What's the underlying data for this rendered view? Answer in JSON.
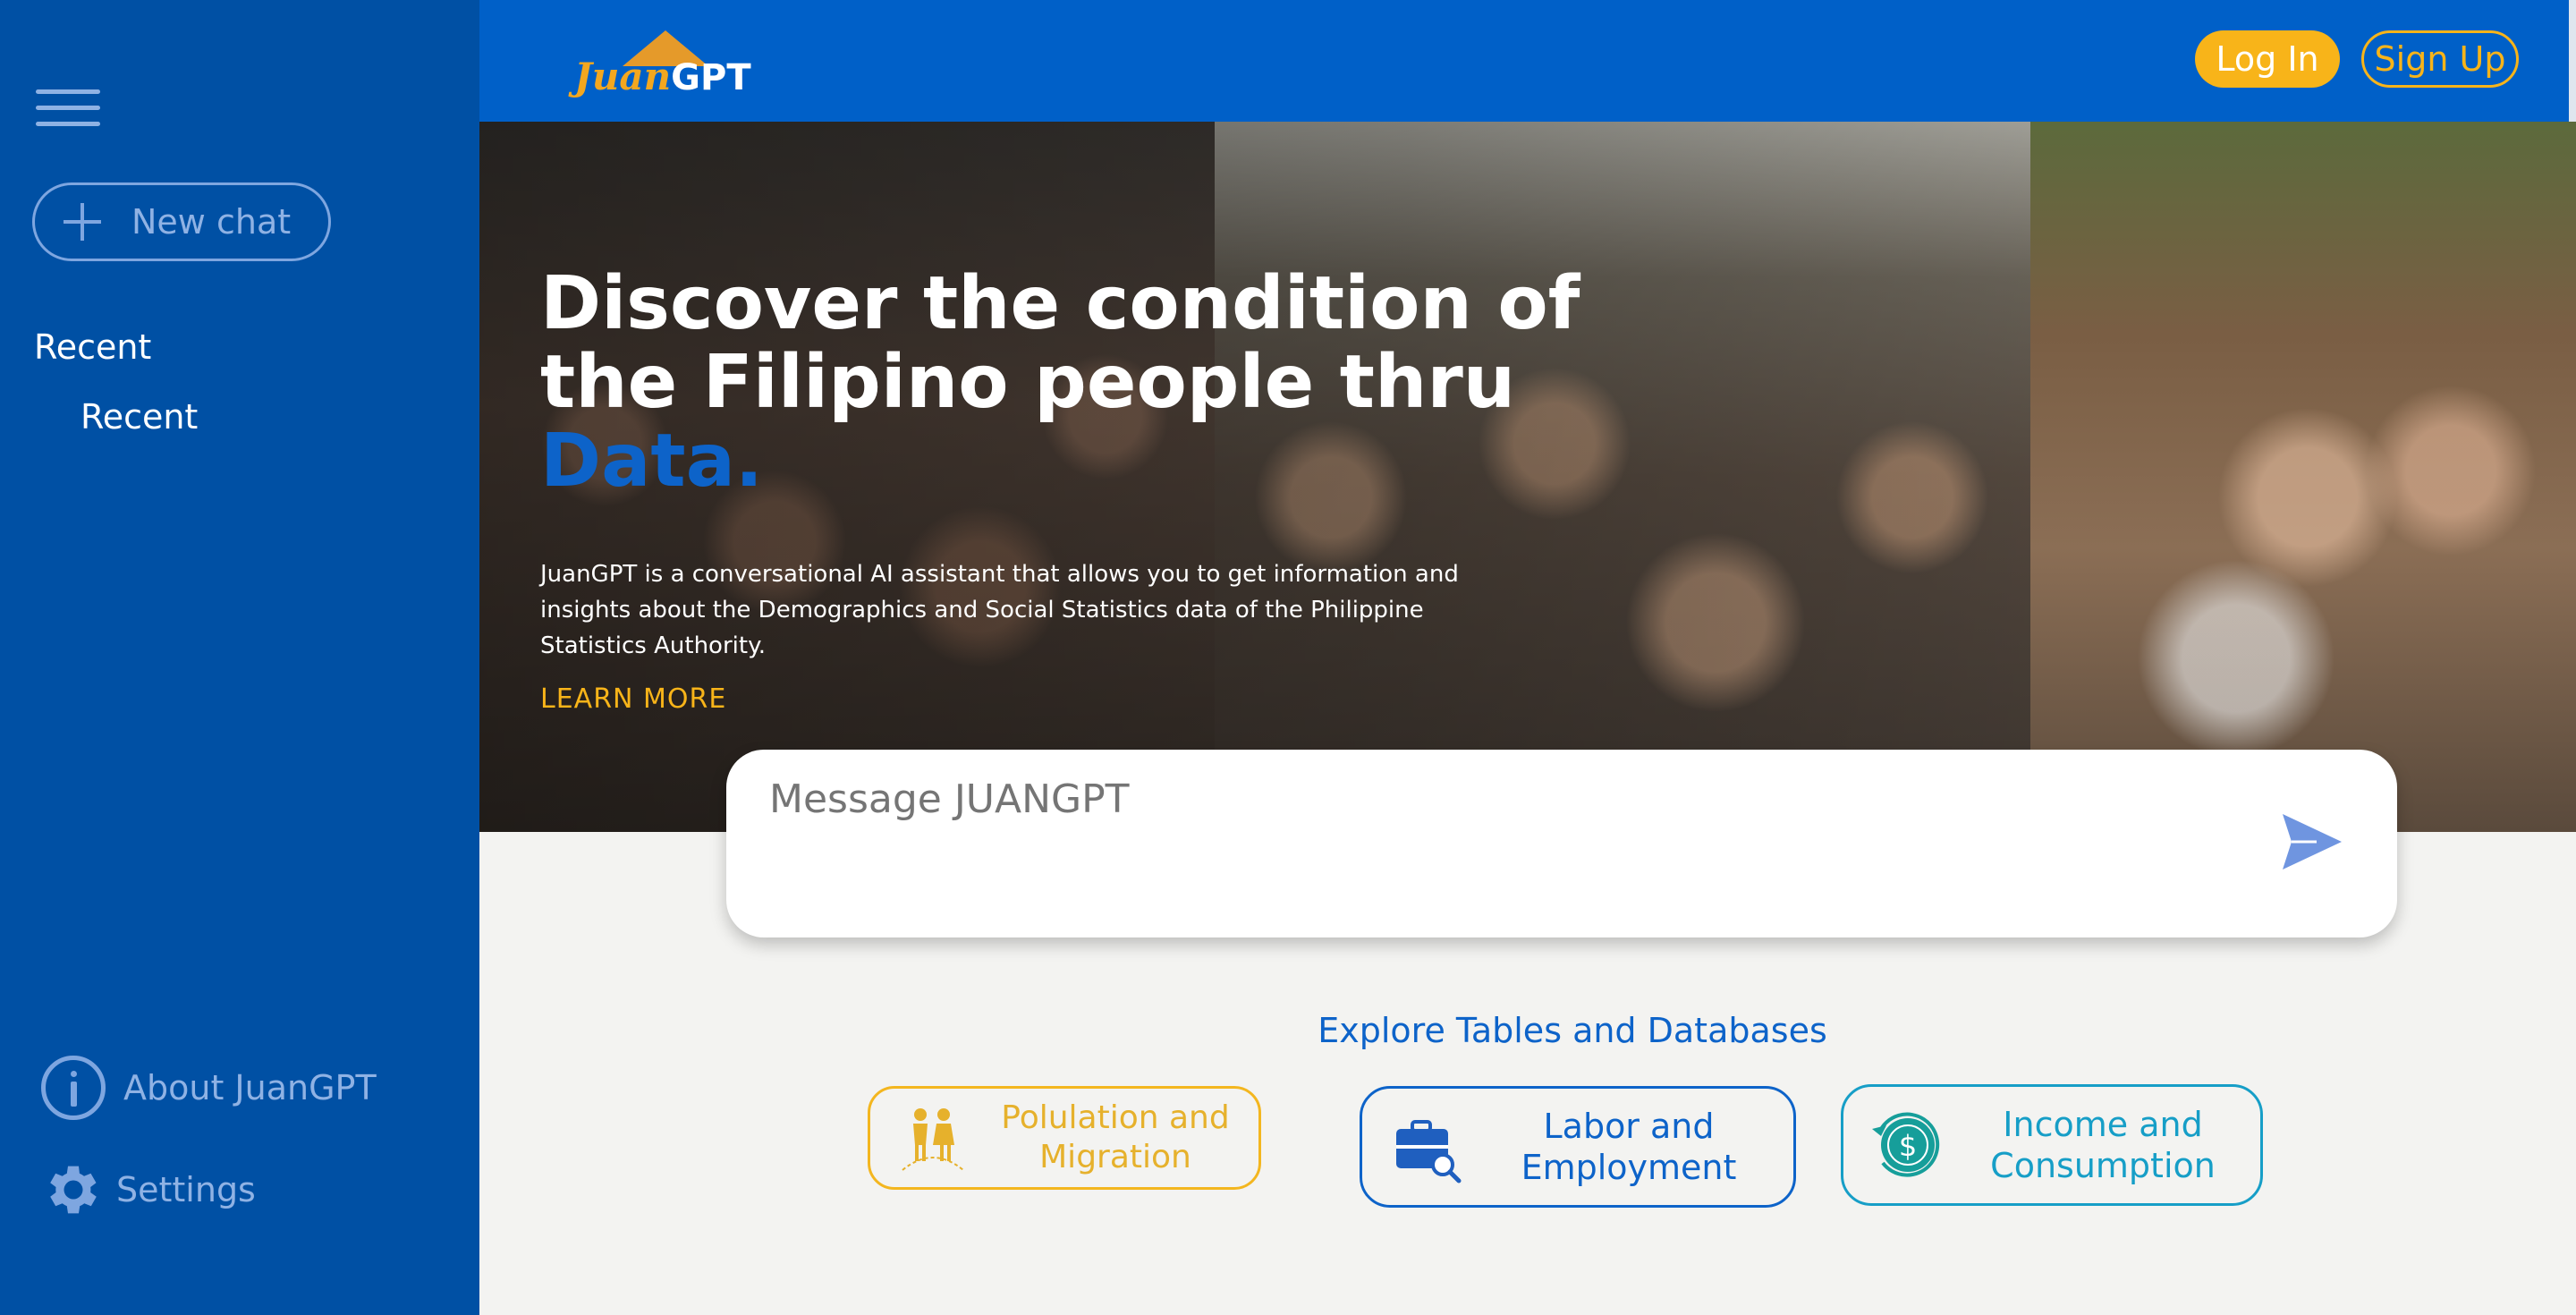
{
  "sidebar": {
    "new_chat_label": "New chat",
    "recent_heading": "Recent",
    "recent_items": [
      {
        "label": "Recent"
      }
    ],
    "about_label": "About JuanGPT",
    "settings_label": "Settings",
    "icons": {
      "menu": "hamburger-menu-icon",
      "new_chat": "plus-icon",
      "about": "info-icon",
      "settings": "gear-icon"
    }
  },
  "header": {
    "logo": {
      "text_script": "Juan",
      "text_bold": "GPT"
    },
    "login_label": "Log In",
    "signup_label": "Sign Up"
  },
  "hero": {
    "headline_line1": "Discover the condition of",
    "headline_line2": "the Filipino people thru",
    "headline_accent": "Data.",
    "description": "JuanGPT is a conversational AI assistant that allows you to get information and insights about the Demographics and Social Statistics data of the Philippine Statistics Authority.",
    "learn_more_label": "LEARN MORE"
  },
  "composer": {
    "placeholder": "Message JUANGPT",
    "send_icon": "send-icon"
  },
  "explore": {
    "title": "Explore Tables and Databases",
    "tiles": [
      {
        "label_line1": "Polulation and",
        "label_line2": "Migration",
        "icon": "population-icon"
      },
      {
        "label_line1": "Labor and",
        "label_line2": "Employment",
        "icon": "briefcase-search-icon"
      },
      {
        "label_line1": "Income and",
        "label_line2": "Consumption",
        "icon": "dollar-refresh-icon"
      }
    ]
  },
  "colors": {
    "sidebar_bg": "#0050a4",
    "topbar_bg": "#0060c8",
    "accent_blue": "#0d63c9",
    "accent_yellow": "#f8b419",
    "teal": "#169ec7",
    "page_bg": "#f3f3f1"
  }
}
